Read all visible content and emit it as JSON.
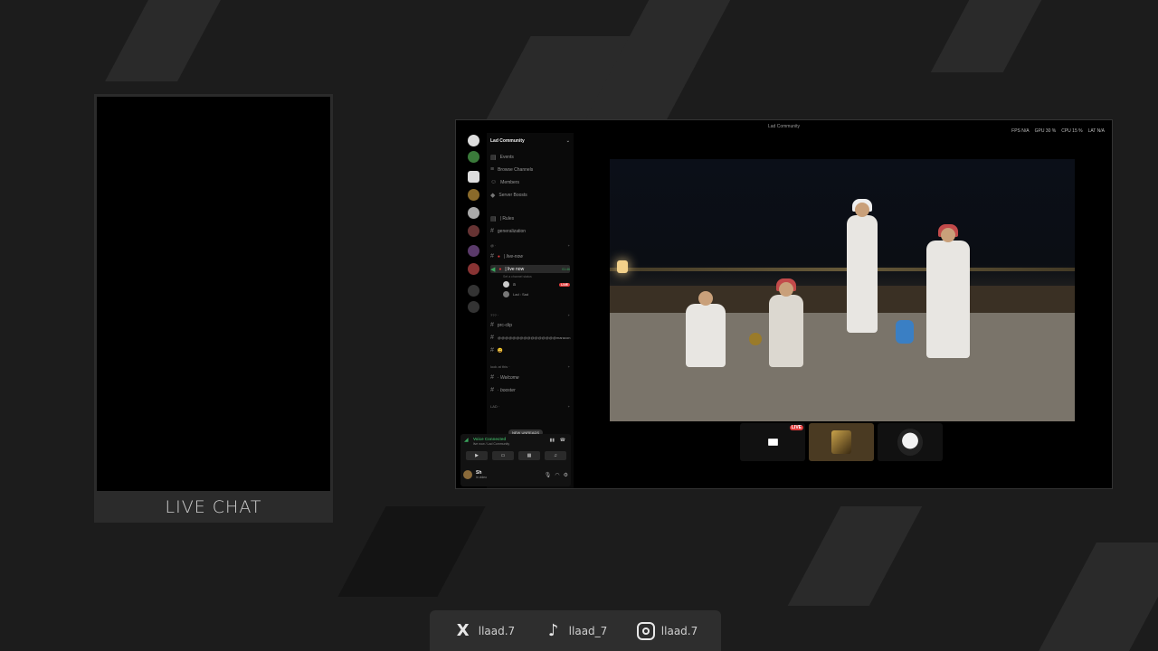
{
  "live_chat": {
    "label": "LIVE CHAT"
  },
  "window": {
    "title": "Lad Community",
    "stats": {
      "fps": "FPS N/A",
      "gpu": "GPU 30 %",
      "cpu": "CPU 15 %",
      "lat": "LAT N/A"
    }
  },
  "sidebar": {
    "guild_name": "Lad Community",
    "top_items": [
      "Events",
      "Browse Channels",
      "Members",
      "Server Boosts"
    ],
    "channels": [
      {
        "label": "| Rules",
        "type": "text"
      },
      {
        "label": "generalization",
        "type": "text"
      }
    ],
    "category_1": "@ ·",
    "live_channel_1": "| live-now",
    "live_channel_active": "| live now",
    "live_channel_timer": "01:46",
    "live_channel_sub": "Set a channel status",
    "voice_user_1": "a",
    "voice_user_2": "Lad : Sad",
    "live_tag": "LIVE",
    "category_2": "??? ·",
    "channels_2": [
      "prc-clip",
      "@@@@@@@@@@@@@@@@maracon",
      "😄"
    ],
    "category_3": "look at this ·",
    "channels_3": [
      "· Welcome",
      "· booster"
    ],
    "category_4": "LAD ·",
    "unreads_pill": "NEW UNREADS",
    "voice": {
      "status": "Voice Connected",
      "sub": "live now / Lad Community"
    },
    "user": {
      "name": "Sh",
      "status": "in video"
    }
  },
  "stream": {
    "live_badge": "LIVE"
  },
  "socials": [
    {
      "icon": "x-icon",
      "glyph": "X",
      "handle": "llaad.7"
    },
    {
      "icon": "tiktok-icon",
      "glyph": "♪",
      "handle": "llaad_7"
    },
    {
      "icon": "instagram-icon",
      "glyph": "",
      "handle": "llaad.7"
    }
  ],
  "colors": {
    "live": "#e03a3a",
    "voice_connected": "#3ba55d",
    "background": "#1c1c1c"
  }
}
